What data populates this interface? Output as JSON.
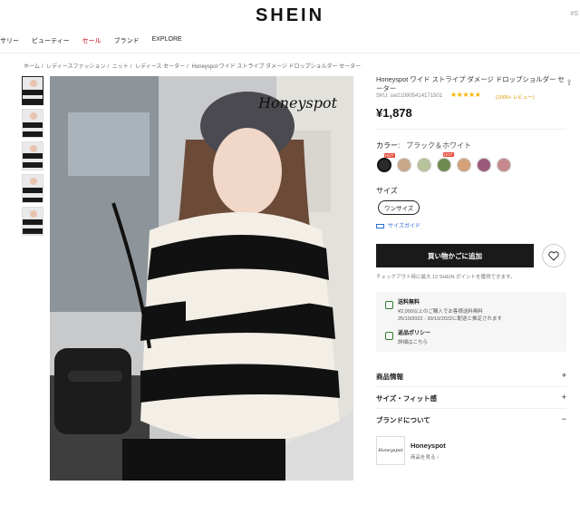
{
  "header": {
    "logo": "SHEIN",
    "corner": "#S"
  },
  "nav": [
    "サリー",
    "ビューティー",
    "セール",
    "ブランド",
    "EXPLORE"
  ],
  "breadcrumb": [
    "ホーム",
    "/",
    "レディースファッション",
    "/",
    "ニット",
    "/",
    "レディース セーター",
    "/",
    "Honeyspot ワイド ストライプ ダメージ ドロップショルダー セーター"
  ],
  "product": {
    "brand_mark": "Honeyspot",
    "title": "Honeyspot ワイド ストライプ ダメージ ドロップショルダー セーター",
    "sku": "SKU: sw2109054141715​01",
    "stars": "★★★★★",
    "reviews": "(1000+ レビュー)",
    "price": "¥1,878",
    "color_label": "カラー:",
    "color_value": "ブラック＆ホワイト",
    "swatch_hot": "HOT",
    "size_label": "サイズ",
    "size_option": "ワンサイズ",
    "size_guide": "サイズガイド",
    "add_to_cart": "買い物かごに追加",
    "points_note": "チェックアウト時に最大 12 SHEIN ポイントを獲得できます。"
  },
  "infobox": {
    "shipping_title": "送料無料",
    "shipping_line1": "¥2,000以上のご購入でお客様送料無料",
    "shipping_line2": "25/10/2022 - 30/10/2022に配送と推定されます",
    "return_title": "返品ポリシー",
    "return_line": "詳細はこちら"
  },
  "accordion": [
    "商品情報",
    "サイズ・フィット感",
    "ブランドについて"
  ],
  "brand": {
    "logo_text": "Honeyspot",
    "name": "Honeyspot",
    "link": "商品を見る ›"
  },
  "colors": {
    "swatches": [
      "#2b2b2b",
      "#c9a88a",
      "#b7c49a",
      "#6f8a4f",
      "#d3a27a",
      "#9c5a7a",
      "#c68a8e"
    ],
    "accent_red": "#d0021b",
    "star": "#f5b400"
  }
}
